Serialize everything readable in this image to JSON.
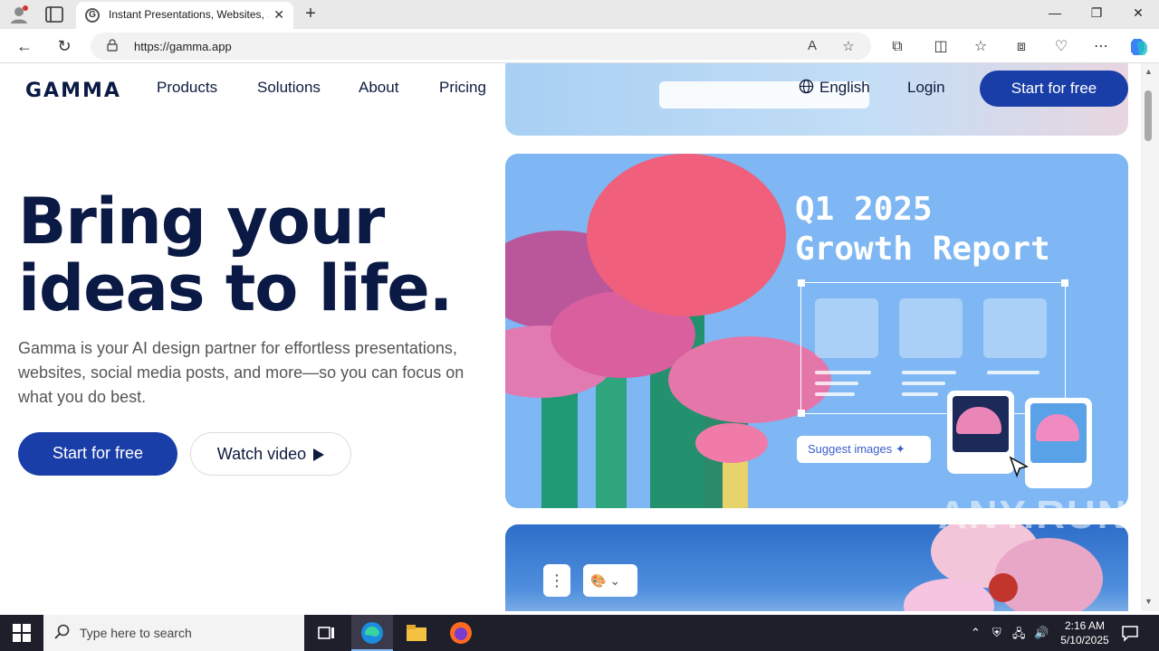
{
  "browser": {
    "tab_title": "Instant Presentations, Websites, a",
    "tab_favicon": "G",
    "url": "https://gamma.app",
    "new_tab": "+",
    "minimize": "—",
    "restore": "❐",
    "close": "✕"
  },
  "site": {
    "logo": "GAMMA",
    "nav": [
      "Products",
      "Solutions",
      "About",
      "Pricing"
    ],
    "language": "English",
    "login": "Login",
    "cta_top": "Start for free",
    "hero_title": "Bring your ideas to life.",
    "hero_subtitle": "Gamma is your AI design partner for effortless presentations, websites, social media posts, and more—so you can focus on what you do best.",
    "cta_primary": "Start for free",
    "cta_secondary": "Watch video",
    "card_title_line1": "Q1 2025",
    "card_title_line2": "Growth Report",
    "suggest_label": "Suggest images",
    "watermark": "ANY.RUN"
  },
  "taskbar": {
    "search_placeholder": "Type here to search",
    "time": "2:16 AM",
    "date": "5/10/2025"
  },
  "colors": {
    "brand_blue": "#1a3ea8",
    "heading_navy": "#0b1a45",
    "card_blue": "#7eb7f3"
  }
}
